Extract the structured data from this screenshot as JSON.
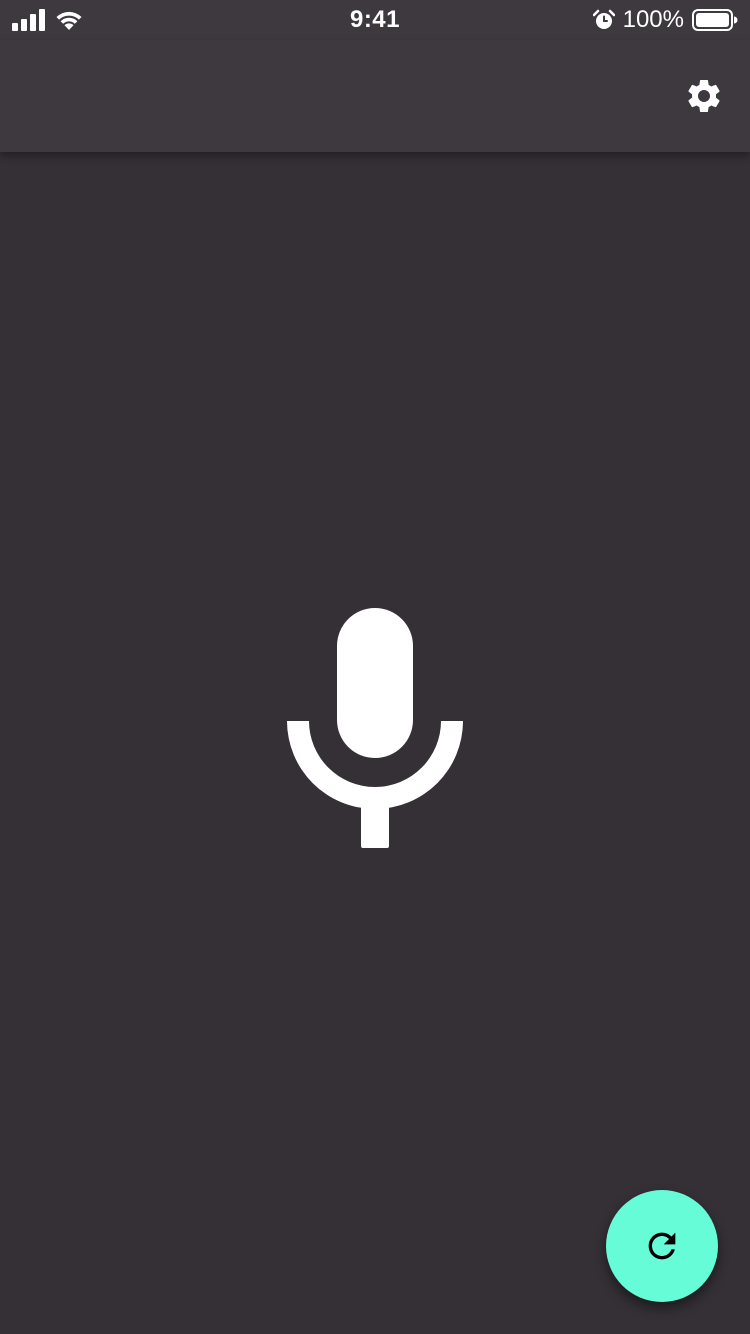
{
  "status_bar": {
    "time": "9:41",
    "battery": "100%",
    "icons": [
      "signal-icon",
      "wifi-icon",
      "alarm-icon",
      "battery-icon"
    ]
  },
  "app_bar": {
    "action_icon": "gear-icon"
  },
  "main": {
    "center_icon": "microphone-icon"
  },
  "fab": {
    "icon": "refresh-icon"
  },
  "colors": {
    "background": "#343036",
    "app_bar": "#3d393f",
    "fab": "#67fcd8",
    "icon": "#ffffff",
    "fab_icon": "#000000"
  }
}
